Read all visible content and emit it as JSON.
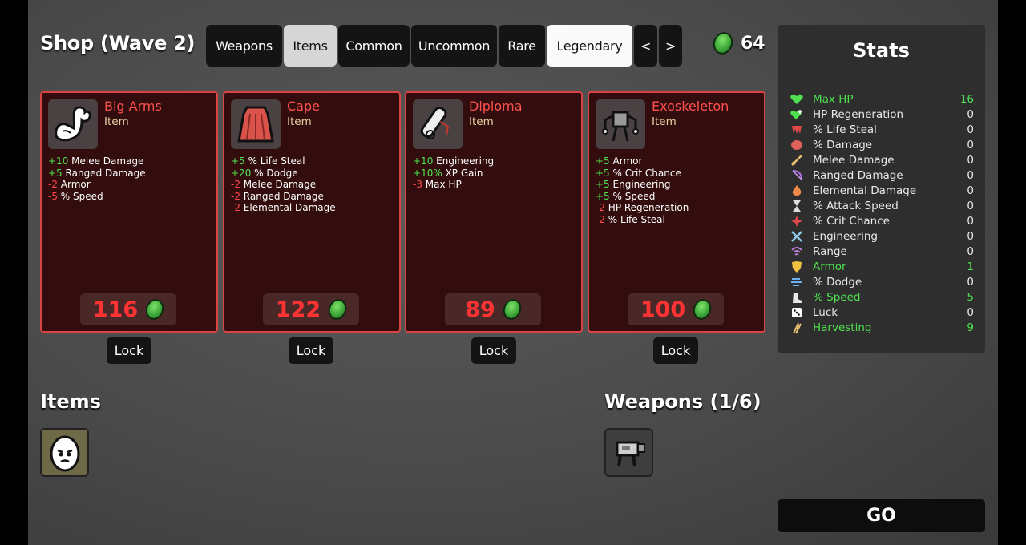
{
  "shop": {
    "title": "Shop (Wave 2)"
  },
  "tabs": [
    {
      "label": "Weapons"
    },
    {
      "label": "Items"
    },
    {
      "label": "Common"
    },
    {
      "label": "Uncommon"
    },
    {
      "label": "Rare"
    },
    {
      "label": "Legendary"
    },
    {
      "label": "<"
    },
    {
      "label": ">"
    }
  ],
  "currency": {
    "amount": "64",
    "icon": "material-coin-icon",
    "color": "#4caf50"
  },
  "cards": [
    {
      "name": "Big Arms",
      "type": "Item",
      "icon": "flexing-arm-icon",
      "price": "116",
      "stats": [
        {
          "delta": "+10",
          "label": "Melee Damage",
          "positive": true
        },
        {
          "delta": "+5",
          "label": "Ranged Damage",
          "positive": true
        },
        {
          "delta": "-2",
          "label": "Armor",
          "positive": false
        },
        {
          "delta": "-5",
          "label": "% Speed",
          "positive": false
        }
      ],
      "lock_label": "Lock"
    },
    {
      "name": "Cape",
      "type": "Item",
      "icon": "cape-icon",
      "price": "122",
      "stats": [
        {
          "delta": "+5",
          "label": "% Life Steal",
          "positive": true
        },
        {
          "delta": "+20",
          "label": "% Dodge",
          "positive": true
        },
        {
          "delta": "-2",
          "label": "Melee Damage",
          "positive": false
        },
        {
          "delta": "-2",
          "label": "Ranged Damage",
          "positive": false
        },
        {
          "delta": "-2",
          "label": "Elemental Damage",
          "positive": false
        }
      ],
      "lock_label": "Lock"
    },
    {
      "name": "Diploma",
      "type": "Item",
      "icon": "diploma-scroll-icon",
      "price": "89",
      "stats": [
        {
          "delta": "+10",
          "label": "Engineering",
          "positive": true
        },
        {
          "delta": "+10%",
          "label": "XP Gain",
          "positive": true
        },
        {
          "delta": "-3",
          "label": "Max HP",
          "positive": false
        }
      ],
      "lock_label": "Lock"
    },
    {
      "name": "Exoskeleton",
      "type": "Item",
      "icon": "exoskeleton-icon",
      "price": "100",
      "stats": [
        {
          "delta": "+5",
          "label": "Armor",
          "positive": true
        },
        {
          "delta": "+5",
          "label": "% Crit Chance",
          "positive": true
        },
        {
          "delta": "+5",
          "label": "Engineering",
          "positive": true
        },
        {
          "delta": "+5",
          "label": "% Speed",
          "positive": true
        },
        {
          "delta": "-2",
          "label": "HP Regeneration",
          "positive": false
        },
        {
          "delta": "-2",
          "label": "% Life Steal",
          "positive": false
        }
      ],
      "lock_label": "Lock"
    }
  ],
  "inventory": {
    "items_heading": "Items",
    "weapons_heading": "Weapons (1/6)",
    "items": [
      {
        "icon": "potato-character-icon"
      }
    ],
    "weapons": [
      {
        "icon": "turret-gun-icon"
      }
    ]
  },
  "stats_panel": {
    "title": "Stats",
    "rows": [
      {
        "label": "Max HP",
        "value": "16",
        "highlight": true,
        "icon": "heart-icon"
      },
      {
        "label": "HP Regeneration",
        "value": "0",
        "highlight": false,
        "icon": "heart-plus-icon"
      },
      {
        "label": "% Life Steal",
        "value": "0",
        "highlight": false,
        "icon": "fangs-icon"
      },
      {
        "label": "% Damage",
        "value": "0",
        "highlight": false,
        "icon": "muscle-icon"
      },
      {
        "label": "Melee Damage",
        "value": "0",
        "highlight": false,
        "icon": "sword-icon"
      },
      {
        "label": "Ranged Damage",
        "value": "0",
        "highlight": false,
        "icon": "bow-icon"
      },
      {
        "label": "Elemental Damage",
        "value": "0",
        "highlight": false,
        "icon": "flame-icon"
      },
      {
        "label": "% Attack Speed",
        "value": "0",
        "highlight": false,
        "icon": "hourglass-icon"
      },
      {
        "label": "% Crit Chance",
        "value": "0",
        "highlight": false,
        "icon": "crit-burst-icon"
      },
      {
        "label": "Engineering",
        "value": "0",
        "highlight": false,
        "icon": "wrench-icon"
      },
      {
        "label": "Range",
        "value": "0",
        "highlight": false,
        "icon": "range-waves-icon"
      },
      {
        "label": "Armor",
        "value": "1",
        "highlight": true,
        "icon": "shield-icon"
      },
      {
        "label": "% Dodge",
        "value": "0",
        "highlight": false,
        "icon": "dodge-wind-icon"
      },
      {
        "label": "% Speed",
        "value": "5",
        "highlight": true,
        "icon": "boot-icon"
      },
      {
        "label": "Luck",
        "value": "0",
        "highlight": false,
        "icon": "dice-icon"
      },
      {
        "label": "Harvesting",
        "value": "9",
        "highlight": true,
        "icon": "wheat-icon"
      }
    ]
  },
  "go_button": {
    "label": "GO"
  }
}
